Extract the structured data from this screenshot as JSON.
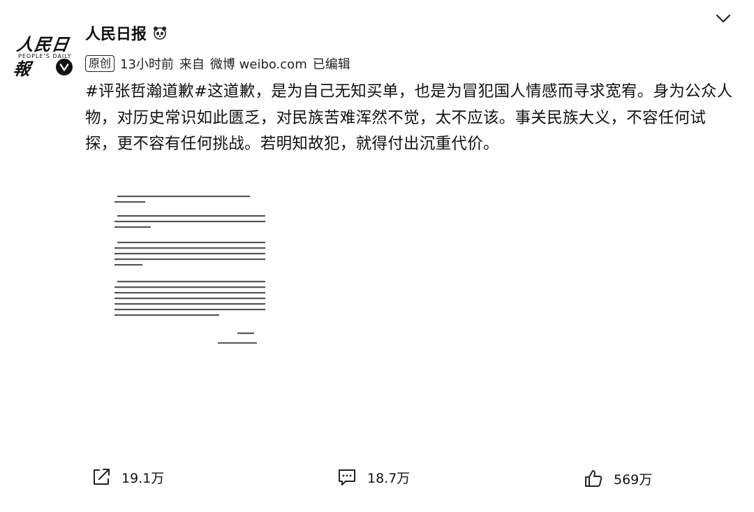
{
  "author": {
    "name": "人民日报",
    "avatar_text": "人民日報",
    "avatar_subtext": "PEOPLE'S DAILY",
    "level_icon": "panda-icon",
    "verified_icon": "verified-v-icon"
  },
  "meta": {
    "original_badge": "原创",
    "time": "13小时前",
    "source_prefix": "来自",
    "source": "微博 weibo.com",
    "edited": "已编辑"
  },
  "post": {
    "text": "#评张哲瀚道歉#这道歉，是为自己无知买单，也是为冒犯国人情感而寻求宽宥。身为公众人物，对历史常识如此匮乏，对民族苦难浑然不觉，太不应该。事关民族大义，不容任何试探，更不容有任何挑战。若明知故犯，就得付出沉重代价。",
    "image": "apology-letter-image"
  },
  "actions": {
    "repost_count": "19.1万",
    "comment_count": "18.7万",
    "like_count": "569万"
  },
  "icons": {
    "repost": "repost-icon",
    "comment": "comment-icon",
    "like": "thumbs-up-icon",
    "menu": "chevron-down-icon"
  }
}
